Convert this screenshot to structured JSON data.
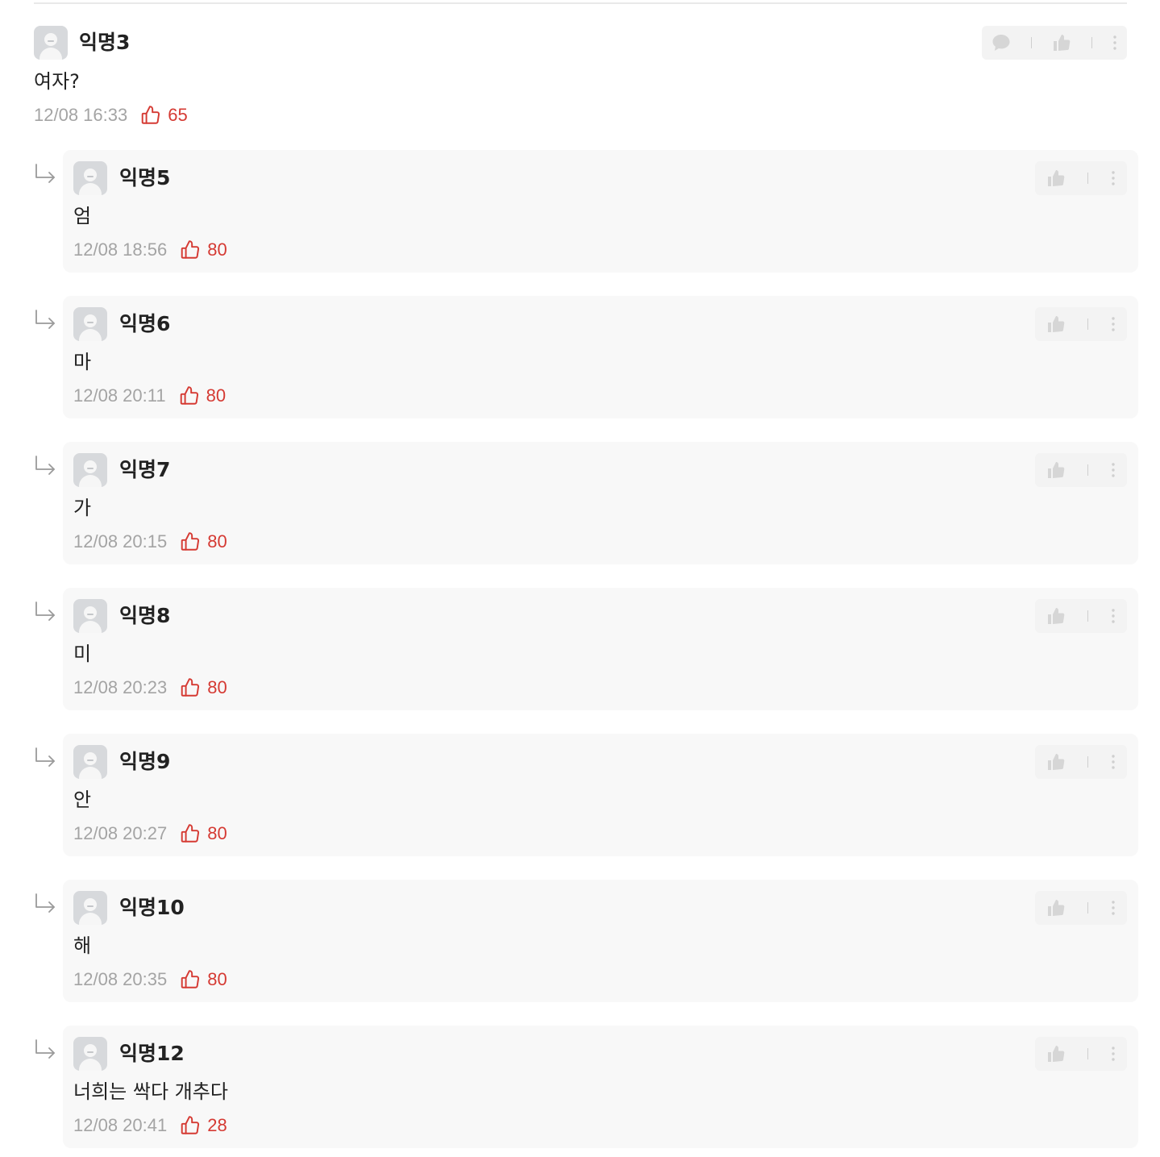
{
  "parent": {
    "nickname": "익명3",
    "text": "여자?",
    "time": "12/08 16:33",
    "likes": "65"
  },
  "replies": [
    {
      "nickname": "익명5",
      "text": "엄",
      "time": "12/08 18:56",
      "likes": "80"
    },
    {
      "nickname": "익명6",
      "text": "마",
      "time": "12/08 20:11",
      "likes": "80"
    },
    {
      "nickname": "익명7",
      "text": "가",
      "time": "12/08 20:15",
      "likes": "80"
    },
    {
      "nickname": "익명8",
      "text": "미",
      "time": "12/08 20:23",
      "likes": "80"
    },
    {
      "nickname": "익명9",
      "text": "안",
      "time": "12/08 20:27",
      "likes": "80"
    },
    {
      "nickname": "익명10",
      "text": "해",
      "time": "12/08 20:35",
      "likes": "80"
    },
    {
      "nickname": "익명12",
      "text": "너희는 싹다 개추다",
      "time": "12/08 20:41",
      "likes": "28"
    }
  ],
  "colors": {
    "like_red": "#d53a33",
    "time_gray": "#a4a4a4",
    "reply_bg": "#f8f8f8",
    "action_bg": "#f3f3f3",
    "action_icon": "#d6d6d6"
  },
  "icons": {
    "reply": "reply-arrow-icon",
    "avatar": "anonymous-avatar-icon",
    "like": "thumbs-up-outline-icon",
    "comment_action": "speech-bubble-icon",
    "vote_action": "thumbs-up-filled-icon",
    "more": "more-vertical-icon"
  }
}
